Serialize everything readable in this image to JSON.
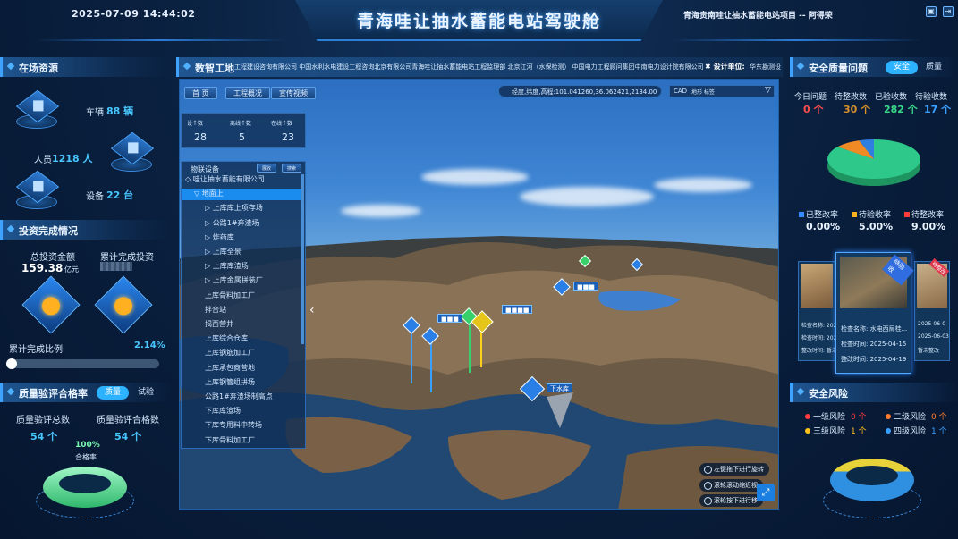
{
  "header": {
    "datetime": "2025-07-09 14:44:02",
    "title": "青海哇让抽水蓄能电站驾驶舱",
    "project": "青海贵南哇让抽水蓄能电站项目 -- 阿得荣"
  },
  "resources": {
    "title": "在场资源",
    "vehicles_label": "车辆",
    "vehicles_value": "88 辆",
    "people_label": "人员",
    "people_value": "1218 人",
    "equipment_label": "设备",
    "equipment_value": "22 台"
  },
  "investment": {
    "title": "投资完成情况",
    "total_label": "总投资金额",
    "total_value": "159.38",
    "total_unit": "亿元",
    "cum_label": "累计完成投资",
    "ratio_label": "累计完成比例",
    "ratio_text": "2.14%",
    "ratio": 0.0214
  },
  "quality_rate": {
    "title": "质量验评合格率",
    "tab_quality": "质量",
    "tab_test": "试验",
    "total_label": "质量验评总数",
    "total_value": "54 个",
    "pass_label": "质量验评合格数",
    "pass_value": "54 个",
    "rate": "100%",
    "rate_label": "合格率"
  },
  "center": {
    "title": "数智工地",
    "orgs": "工程建设咨询有限公司   中国水利水电建设工程咨询北京有限公司青海哇让抽水蓄能电站工程监理部   北京江河（水保检测）   中国电力工程顾问集团中南电力设计院有限公司",
    "design_label": "设计单位:",
    "design_value": "华东勘测设",
    "tabs": [
      "首 页",
      "工程概况",
      "宣传视频"
    ],
    "coords": "经度,纬度,高程:101.041260,36.062421,2134.00",
    "cad_label": "CAD",
    "cad_opts": "地形   标签",
    "stats": [
      {
        "label": "设个数",
        "value": "28"
      },
      {
        "label": "离线个数",
        "value": "5"
      },
      {
        "label": "在线个数",
        "value": "23"
      }
    ],
    "device_title": "物联设备",
    "device_btn1": "展收",
    "device_btn2": "搜索",
    "tree": [
      "哇让抽水蓄能有限公司",
      "地面上",
      "上库库上项存场",
      "公路1#弃渣场",
      "炸药库",
      "上库全景",
      "上库库渣场",
      "上库金属拼装厂",
      "上库骨料加工厂",
      "拌合站",
      "揭西营井",
      "上库综合仓库",
      "上库钢筋加工厂",
      "上库承包商营地",
      "上库钢管组拼场",
      "公路1#弃渣场制高点",
      "下库库渣场",
      "下库专用料中转场",
      "下库骨料加工厂"
    ],
    "hint1": "左键拖下进行旋转",
    "hint2": "滚轮滚动缩近视",
    "hint3": "滚轮按下进行移",
    "map_label_a": "下水库",
    "map_label_b": "上水库"
  },
  "safety": {
    "title": "安全质量问题",
    "tab_safe": "安全",
    "tab_quality": "质量",
    "stats": [
      {
        "label": "今日问题",
        "value": "0 个",
        "color": "#ff4d4d"
      },
      {
        "label": "待整改数",
        "value": "30 个",
        "color": "#d9912b"
      },
      {
        "label": "已验收数",
        "value": "282 个",
        "color": "#39d98a"
      },
      {
        "label": "待验收数",
        "value": "17 个",
        "color": "#3aa0ff"
      }
    ],
    "pie": [
      {
        "value": 282,
        "color": "#2ec98a"
      },
      {
        "value": 30,
        "color": "#f08a24"
      },
      {
        "value": 17,
        "color": "#2f7fe0"
      }
    ],
    "rates": [
      {
        "label": "已整改率",
        "value": "0.00%",
        "color": "#2f8fff"
      },
      {
        "label": "待验收率",
        "value": "5.00%",
        "color": "#ffb020"
      },
      {
        "label": "待整改率",
        "value": "9.00%",
        "color": "#ff3b3b"
      }
    ],
    "card_badge": "待验收",
    "card_badge2": "待整改",
    "card": {
      "name_label": "检查名称:",
      "name_value": "水电西局桂...",
      "time_label": "检查时间:",
      "time_value": "2025-04-15",
      "fix_label": "整改时间:",
      "fix_value": "2025-04-19"
    },
    "left_card": {
      "l1": "检查名称: 202",
      "l2": "检查时间: 202",
      "l3": "整改时间: 暂未"
    },
    "right_card": {
      "l1": "2025-06-0",
      "l2": "2025-06-03",
      "l3": "暂未整改"
    }
  },
  "risk": {
    "title": "安全风险",
    "items": [
      {
        "label": "一级风险",
        "value": "0 个",
        "color": "#ff3b3b"
      },
      {
        "label": "二级风险",
        "value": "0 个",
        "color": "#ff7b2e"
      },
      {
        "label": "三级风险",
        "value": "1 个",
        "color": "#ffc21a"
      },
      {
        "label": "四级风险",
        "value": "1 个",
        "color": "#3aa0ff"
      }
    ]
  }
}
